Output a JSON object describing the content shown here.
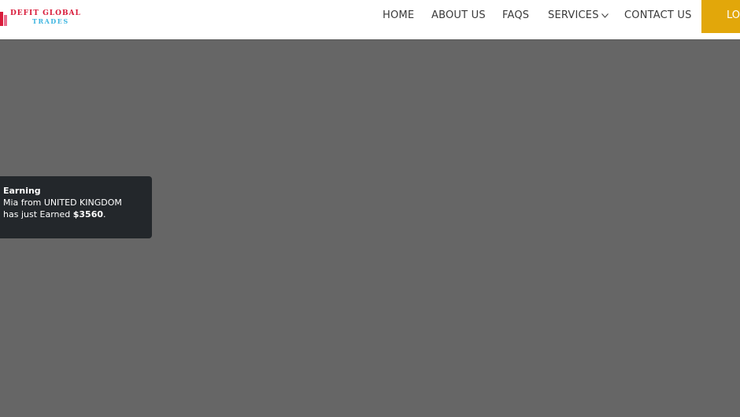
{
  "brand": {
    "line1": "DEFIT GLOBAL",
    "line2": "TRADES",
    "color_line1": "#d81b3a",
    "color_line2": "#3fb6e0"
  },
  "nav": {
    "home": "HOME",
    "about": "ABOUT US",
    "faqs": "FAQS",
    "services": "SERVICES",
    "contact": "CONTACT US",
    "login": "LO"
  },
  "colors": {
    "overlay": "#666666",
    "accent": "#e2a70a",
    "toast_bg": "#23272b"
  },
  "toast": {
    "title": "Earning",
    "line1": "Mia from UNITED KINGDOM",
    "line2_prefix": "has just Earned",
    "amount": "$3560",
    "suffix": "."
  }
}
